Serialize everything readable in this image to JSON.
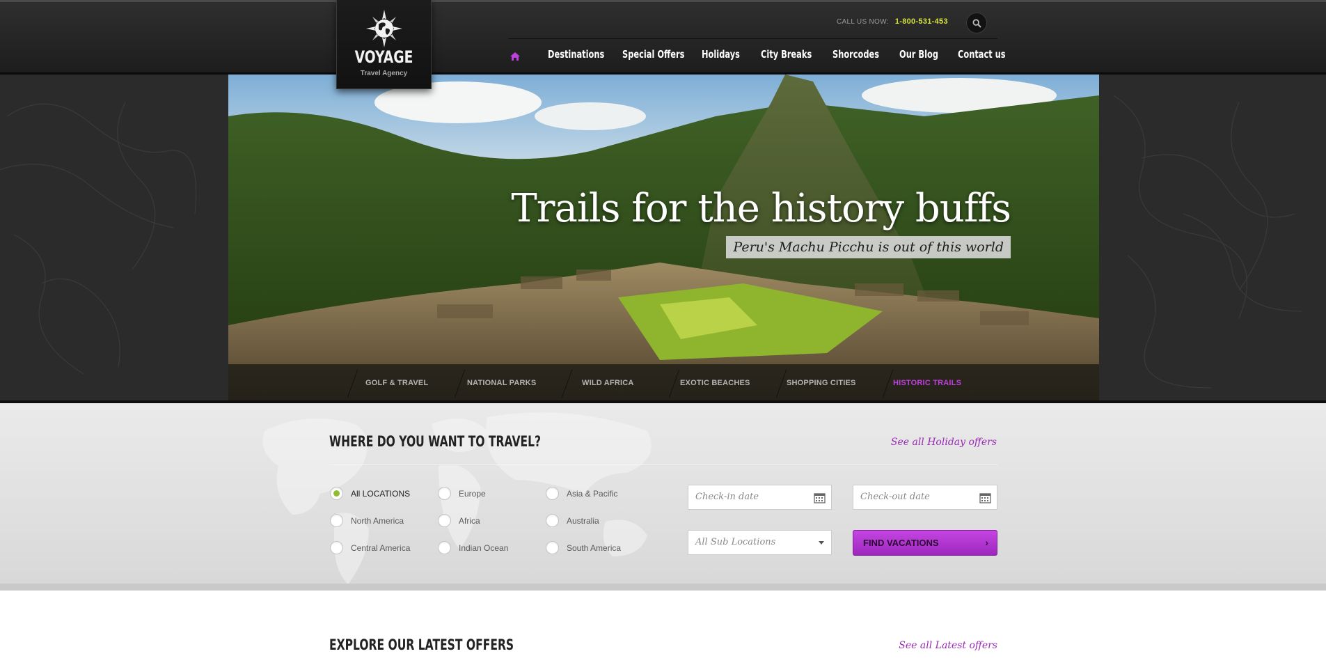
{
  "header": {
    "logo": {
      "name": "VOYAGE",
      "tagline": "Travel Agency"
    },
    "call_label": "CALL US NOW:",
    "call_number": "1-800-531-453",
    "nav": [
      "Destinations",
      "Special Offers",
      "Holidays",
      "City Breaks",
      "Shorcodes",
      "Our Blog",
      "Contact us"
    ],
    "icons": {
      "home": "home-icon",
      "search": "search-icon"
    },
    "accent": "#c13ee0"
  },
  "hero": {
    "title": "Trails for the history buffs",
    "subtitle": "Peru's Machu Picchu is out of this world",
    "tabs": [
      "GOLF & TRAVEL",
      "NATIONAL PARKS",
      "WILD AFRICA",
      "EXOTIC BEACHES",
      "SHOPPING CITIES",
      "HISTORIC TRAILS"
    ],
    "active_tab": "HISTORIC TRAILS"
  },
  "search": {
    "title": "WHERE DO YOU WANT TO TRAVEL?",
    "link": "See all Holiday offers",
    "locations": [
      [
        "All LOCATIONS",
        "Europe",
        "Asia & Pacific"
      ],
      [
        "North America",
        "Africa",
        "Australia"
      ],
      [
        "Central America",
        "Indian Ocean",
        "South America"
      ]
    ],
    "selected_location": "All LOCATIONS",
    "checkin_placeholder": "Check-in date",
    "checkout_placeholder": "Check-out date",
    "sublocation": "All Sub Locations",
    "button": "FIND VACATIONS",
    "icons": {
      "calendar": "calendar-icon",
      "dropdown": "chevron-down-icon",
      "button": "chevron-right-icon"
    }
  },
  "offers": {
    "title": "EXPLORE OUR LATEST OFFERS",
    "link": "See all Latest offers"
  }
}
